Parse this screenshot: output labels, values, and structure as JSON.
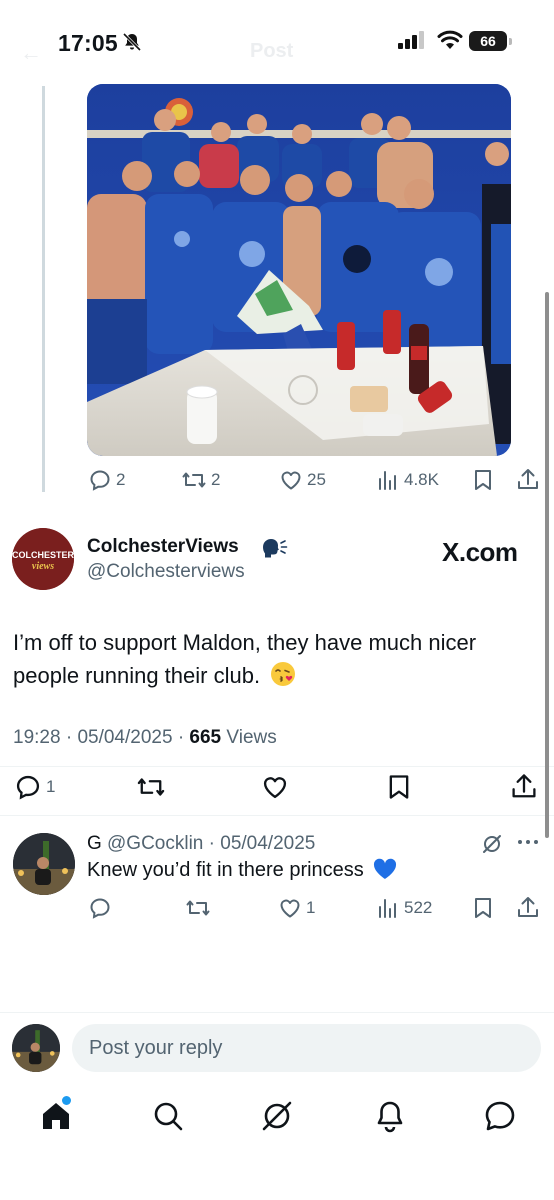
{
  "status_bar": {
    "time": "17:05",
    "battery": "66",
    "icons": [
      "bell-off-icon",
      "signal-icon",
      "wifi-icon",
      "battery-icon"
    ]
  },
  "header": {
    "ghost_title": "Post",
    "ghost_back": "←"
  },
  "quoted_post": {
    "image": "team-celebration-photo",
    "actions": {
      "replies": "2",
      "reposts": "2",
      "likes": "25",
      "views": "4.8K"
    }
  },
  "main_post": {
    "avatar_text": "COLCHESTER",
    "avatar_subtext": "views",
    "display_name": "ColchesterViews",
    "handle": "@Colchesterviews",
    "source_brand": "X.com",
    "text": "I’m off to support Maldon, they have much nicer people running their club.",
    "emoji": "face-blowing-a-kiss",
    "time": "19:28",
    "date": "05/04/2025",
    "views_count": "665",
    "views_label": "Views",
    "actions": {
      "replies": "1"
    }
  },
  "reply": {
    "name": "G",
    "handle": "@GCocklin",
    "date": "05/04/2025",
    "text": "Knew you’d fit in there princess",
    "emoji": "blue-heart",
    "actions": {
      "likes": "1",
      "views": "522"
    }
  },
  "compose": {
    "placeholder": "Post your reply"
  },
  "tab_bar": {
    "tabs": [
      "home-tab",
      "search-tab",
      "grok-tab",
      "notifications-tab",
      "messages-tab"
    ]
  },
  "colors": {
    "text": "#0f1419",
    "secondary": "#536471",
    "accent": "#1d9bf0",
    "divider": "#eff3f4"
  }
}
